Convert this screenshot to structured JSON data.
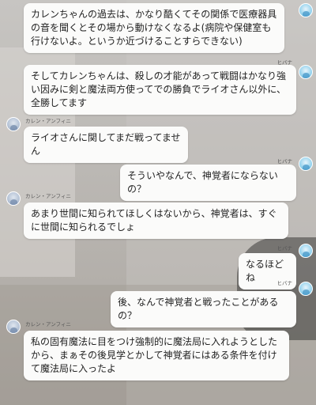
{
  "speakers": {
    "hibana": "ヒバナ",
    "karen": "カレン・アンフィニ"
  },
  "messages": [
    {
      "speaker": "hibana",
      "text": "カレンちゃんの過去は、かなり酷くてその関係で医療器具の音を聞くとその場から動けなくなるよ(病院や保健室も行けないよ。というか近づけることすらできない)"
    },
    {
      "speaker": "hibana",
      "text": "そしてカレンちゃんは、殺しの才能があって戦闘はかなり強い因みに剣と魔法両方使ってでの勝負でライオさん以外に、全勝してます"
    },
    {
      "speaker": "karen",
      "text": "ライオさんに関してまだ戦ってません"
    },
    {
      "speaker": "hibana",
      "text": "そういやなんで、神覚者にならないの？"
    },
    {
      "speaker": "karen",
      "text": "あまり世間に知られてほしくはないから、神覚者は、すぐに世間に知られるでしょ"
    },
    {
      "speaker": "hibana",
      "text": "なるほどね"
    },
    {
      "speaker": "hibana",
      "text": "後、なんで神覚者と戦ったことがあるの？"
    },
    {
      "speaker": "karen",
      "text": "私の固有魔法に目をつけ強制的に魔法局に入れようとしたから、まぁその後見学とかして神覚者にはある条件を付けて魔法局に入ったよ"
    }
  ]
}
